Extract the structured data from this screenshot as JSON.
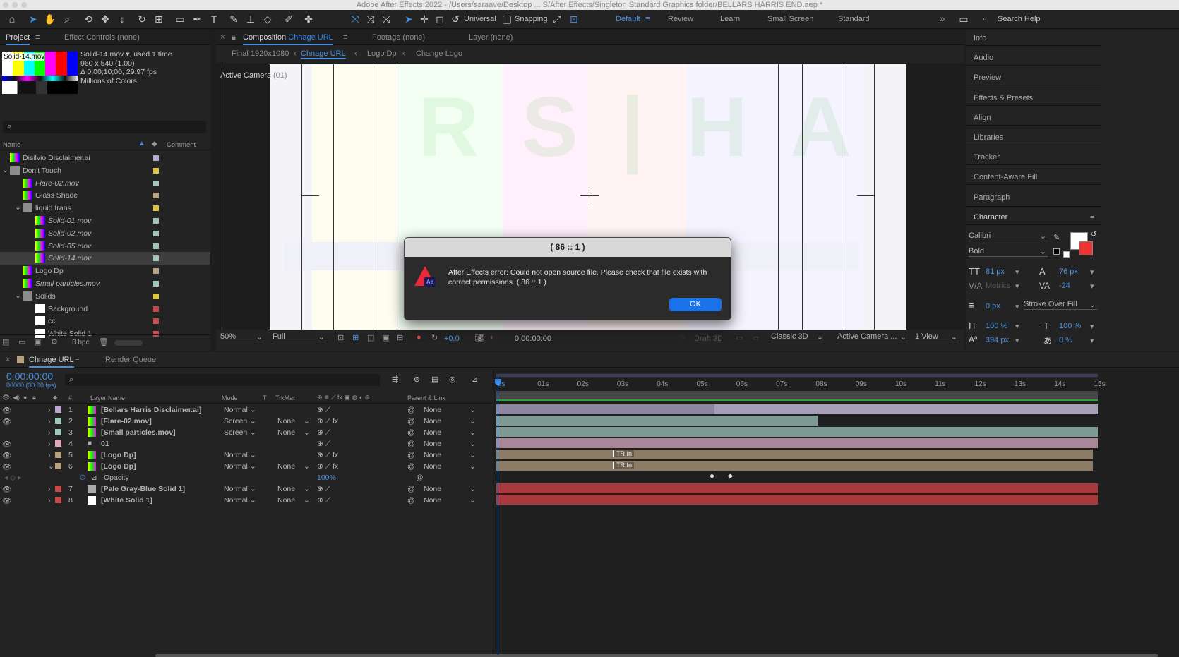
{
  "window": {
    "title": "Adobe After Effects 2022 - /Users/saraave/Desktop ... S/After Effects/Singleton Standard Graphics folder/BELLARS HARRIS END.aep *"
  },
  "toolbar": {
    "universal_label": "Universal",
    "snapping_label": "Snapping"
  },
  "workspaces": [
    "Default",
    "Review",
    "Learn",
    "Small Screen",
    "Standard"
  ],
  "search_help": {
    "placeholder": "Search Help"
  },
  "project_panel": {
    "tab_project": "Project",
    "tab_effect_controls": "Effect Controls (none)",
    "selected": {
      "thumb_label": "Solid-14.mov",
      "name": "Solid-14.mov ▾",
      "used": ", used 1 time",
      "dims": "960 x 540 (1.00)",
      "duration": "Δ 0;00;10;00, 29.97 fps",
      "colors": "Millions of Colors"
    },
    "col_name": "Name",
    "col_comment": "Comment",
    "items": [
      {
        "name": "Disilvio Disclaimer.ai",
        "color": "#b9a6cf"
      },
      {
        "name": "Don't Touch",
        "color": "#e1c33b"
      },
      {
        "name": "Flare-02.mov",
        "color": "#9fc7b9"
      },
      {
        "name": "Glass Shade",
        "color": "#b7a17e"
      },
      {
        "name": "liquid trans",
        "color": "#e1c33b"
      },
      {
        "name": "Solid-01.mov",
        "color": "#9fc7b9"
      },
      {
        "name": "Solid-02.mov",
        "color": "#9fc7b9"
      },
      {
        "name": "Solid-05.mov",
        "color": "#9fc7b9"
      },
      {
        "name": "Solid-14.mov",
        "color": "#9fc7b9"
      },
      {
        "name": "Logo Dp",
        "color": "#b7a17e"
      },
      {
        "name": "Small particles.mov",
        "color": "#9fc7b9"
      },
      {
        "name": "Solids",
        "color": "#e1c33b"
      },
      {
        "name": "Background",
        "color": "#c84b4b"
      },
      {
        "name": "cc",
        "color": "#c84b4b"
      },
      {
        "name": "White Solid 1",
        "color": "#c84b4b"
      }
    ],
    "bpc": "8 bpc"
  },
  "comp_panel": {
    "tab_comp_prefix": "Composition",
    "tab_comp_name": "Chnage URL",
    "tab_footage": "Footage (none)",
    "tab_layer": "Layer (none)",
    "breadcrumbs": [
      "Final 1920x1080",
      "Chnage URL",
      "Logo Dp",
      "Change Logo"
    ],
    "active_camera": "Active Camera",
    "active_camera_num": "(01)",
    "zoom": "50%",
    "resolution": "Full",
    "exposure": "+0.0",
    "timecode": "0:00:00:00",
    "draft3d": "Draft 3D",
    "renderer": "Classic 3D",
    "camera": "Active Camera ...",
    "views": "1 View"
  },
  "right_panel": {
    "items": [
      "Info",
      "Audio",
      "Preview",
      "Effects & Presets",
      "Align",
      "Libraries",
      "Tracker",
      "Content-Aware Fill",
      "Paragraph",
      "Character"
    ],
    "character": {
      "font": "Calibri",
      "style": "Bold",
      "size": "81 px",
      "leading": "76 px",
      "kerning": "Metrics",
      "tracking": "-24",
      "stroke": "0 px",
      "stroke_type": "Stroke Over Fill",
      "vscale": "100 %",
      "hscale": "100 %",
      "baseline": "394 px",
      "tsume": "0 %"
    }
  },
  "dialog": {
    "title": "( 86 :: 1 )",
    "message": "After Effects error: Could not open source file. Please check that file exists with correct permissions. ( 86 :: 1 )",
    "ok": "OK"
  },
  "timeline": {
    "tab_comp": "Chnage URL",
    "tab_render": "Render Queue",
    "timecode": "0:00:00:00",
    "frames": "00000 (30.00 fps)",
    "col_layer_name": "Layer Name",
    "col_mode": "Mode",
    "col_t": "T",
    "col_trkmat": "TrkMat",
    "col_parent": "Parent & Link",
    "ruler": [
      "0s",
      "01s",
      "02s",
      "03s",
      "04s",
      "05s",
      "06s",
      "07s",
      "08s",
      "09s",
      "10s",
      "11s",
      "12s",
      "13s",
      "14s",
      "15s"
    ],
    "layers": [
      {
        "num": "1",
        "name": "[Bellars Harris Disclaimer.ai]",
        "mode": "Normal",
        "trkmat": "",
        "parent": "None",
        "color": "#b9a6cf"
      },
      {
        "num": "2",
        "name": "[Flare-02.mov]",
        "mode": "Screen",
        "trkmat": "None",
        "parent": "None",
        "color": "#9fc7b9"
      },
      {
        "num": "3",
        "name": "[Small particles.mov]",
        "mode": "Screen",
        "trkmat": "None",
        "parent": "None",
        "color": "#9fc7b9"
      },
      {
        "num": "4",
        "name": "01",
        "mode": "",
        "trkmat": "",
        "parent": "None",
        "color": "#e0a6b9"
      },
      {
        "num": "5",
        "name": "[Logo Dp]",
        "mode": "Normal",
        "trkmat": "",
        "parent": "None",
        "color": "#b7a17e"
      },
      {
        "num": "6",
        "name": "[Logo Dp]",
        "mode": "Normal",
        "trkmat": "None",
        "parent": "None",
        "color": "#b7a17e"
      },
      {
        "num": "7",
        "name": "[Pale Gray-Blue Solid 1]",
        "mode": "Normal",
        "trkmat": "None",
        "parent": "None",
        "color": "#c84b4b"
      },
      {
        "num": "8",
        "name": "[White Solid 1]",
        "mode": "Normal",
        "trkmat": "None",
        "parent": "None",
        "color": "#c84b4b"
      }
    ],
    "opacity_label": "Opacity",
    "opacity_value": "100%",
    "marker_label": "TR In"
  }
}
